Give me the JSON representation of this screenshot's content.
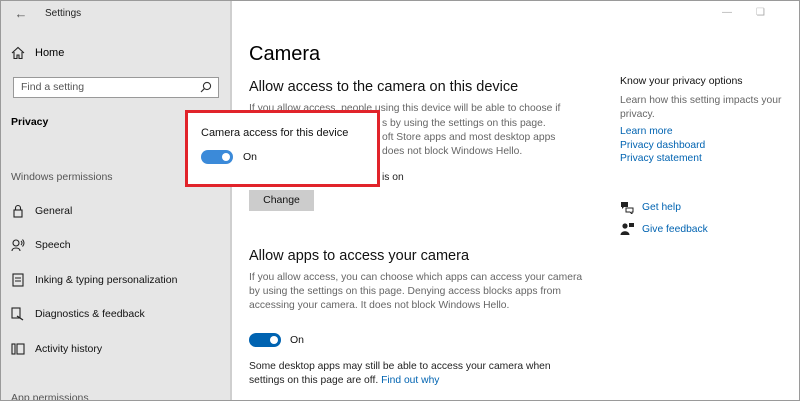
{
  "window": {
    "title": "Settings"
  },
  "sidebar": {
    "home_label": "Home",
    "search_placeholder": "Find a setting",
    "active_section": "Privacy",
    "group1_label": "Windows permissions",
    "items": [
      {
        "label": "General",
        "icon": "lock-icon"
      },
      {
        "label": "Speech",
        "icon": "speech-icon"
      },
      {
        "label": "Inking & typing personalization",
        "icon": "inking-icon"
      },
      {
        "label": "Diagnostics & feedback",
        "icon": "diagnostics-icon"
      },
      {
        "label": "Activity history",
        "icon": "activity-icon"
      }
    ],
    "group2_label": "App permissions"
  },
  "main": {
    "page_title": "Camera",
    "section1_heading": "Allow access to the camera on this device",
    "section1_lines": [
      "If you allow access, people using this device will be able to choose if",
      "s by using the settings on this page.",
      "oft Store apps and most desktop apps",
      "does not block Windows Hello."
    ],
    "section1_status_partial": "is on",
    "change_button": "Change",
    "section2_heading": "Allow apps to access your camera",
    "section2_lines": [
      "If you allow access, you can choose which apps can access your camera",
      "by using the settings on this page. Denying access blocks apps from",
      "accessing your camera. It does not block Windows Hello."
    ],
    "apps_toggle_label": "On",
    "apps_toggle_state": true,
    "desktop_note_line1": "Some desktop apps may still be able to access your camera when",
    "desktop_note_line2": "settings on this page are off.",
    "find_out_why": "Find out why"
  },
  "overlay": {
    "title": "Camera access for this device",
    "toggle_label": "On",
    "toggle_state": true,
    "border_color": "#e1232a"
  },
  "right_column": {
    "title": "Know your privacy options",
    "description": "Learn how this setting impacts your privacy.",
    "links": [
      "Learn more",
      "Privacy dashboard",
      "Privacy statement"
    ],
    "get_help": "Get help",
    "give_feedback": "Give feedback"
  },
  "colors": {
    "accent": "#0063b1",
    "sidebar_bg": "#e6e6e6"
  }
}
